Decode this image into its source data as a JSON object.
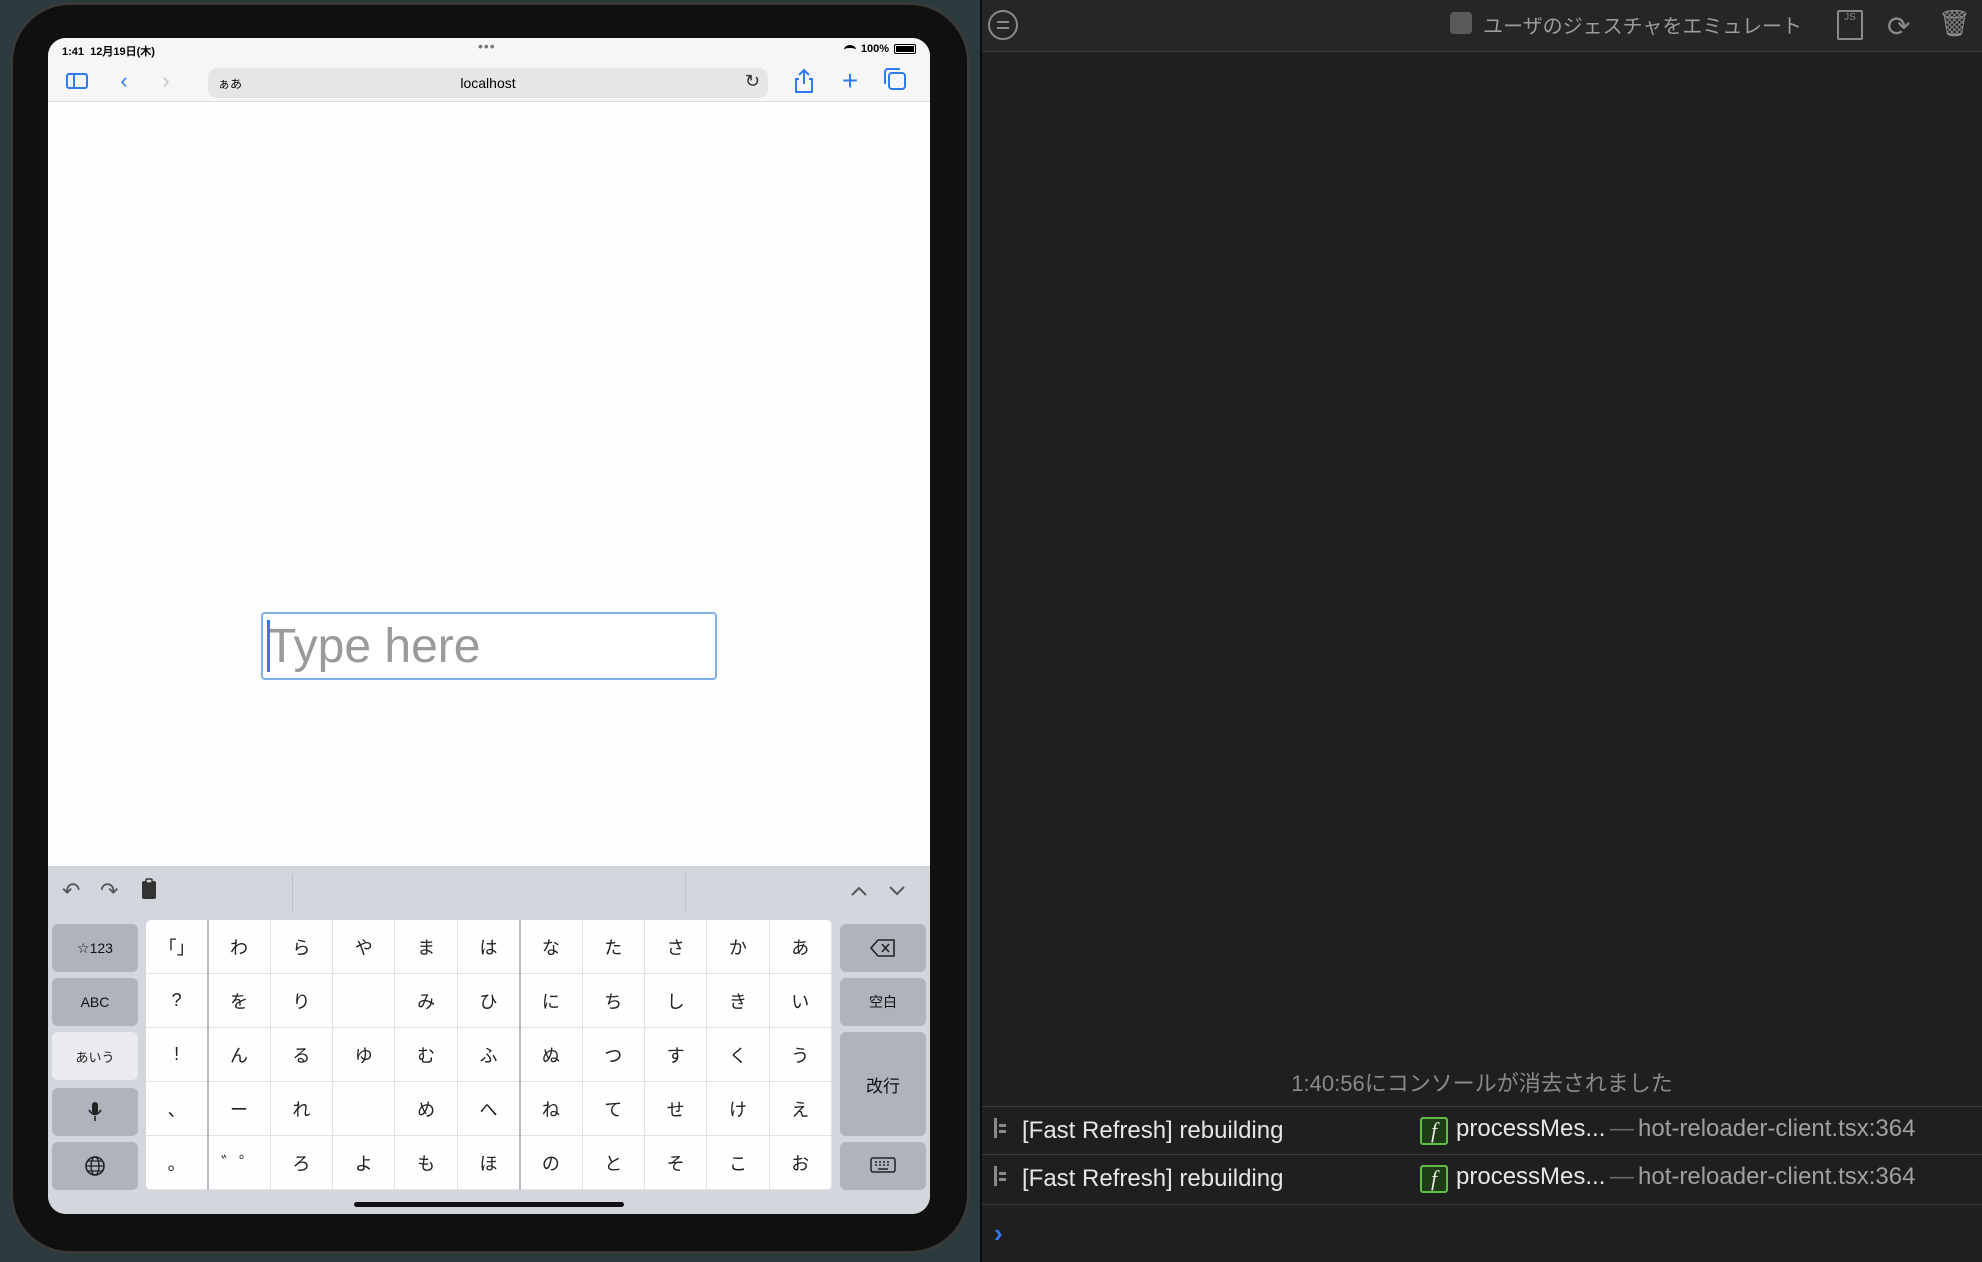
{
  "status_bar": {
    "time": "1:41",
    "date": "12月19日(木)",
    "dots": "•••",
    "battery": "100%"
  },
  "browser": {
    "text_size_label": "ぁあ",
    "url": "localhost",
    "icons": [
      "sidebar-icon",
      "back-icon",
      "forward-icon",
      "reload-icon",
      "share-icon",
      "plus-icon",
      "tabs-icon"
    ]
  },
  "page": {
    "input_placeholder": "Type here",
    "input_value": ""
  },
  "keyboard": {
    "toolbar_icons": [
      "undo-icon",
      "redo-icon",
      "paste-icon",
      "chevron-up-icon",
      "chevron-down-icon"
    ],
    "left_keys": [
      "☆123",
      "ABC",
      "あいう"
    ],
    "right_keys": {
      "space": "空白",
      "enter": "改行"
    },
    "grid": [
      [
        "「」",
        "わ",
        "ら",
        "や",
        "ま",
        "は",
        "な",
        "た",
        "さ",
        "か",
        "あ"
      ],
      [
        "?",
        "を",
        "り",
        "",
        "み",
        "ひ",
        "に",
        "ち",
        "し",
        "き",
        "い"
      ],
      [
        "!",
        "ん",
        "る",
        "ゆ",
        "む",
        "ふ",
        "ぬ",
        "つ",
        "す",
        "く",
        "う"
      ],
      [
        "、",
        "ー",
        "れ",
        "",
        "め",
        "へ",
        "ね",
        "て",
        "せ",
        "け",
        "え"
      ],
      [
        "。",
        "゛゜",
        "ろ",
        "よ",
        "も",
        "ほ",
        "の",
        "と",
        "そ",
        "こ",
        "お"
      ]
    ]
  },
  "console": {
    "emulate_label": "ユーザのジェスチャをエミュレート",
    "js_label": "JS",
    "cleared_message": "1:40:56にコンソールが消去されました",
    "messages": [
      {
        "text": "[Fast Refresh] rebuilding",
        "badge": "f",
        "function": "processMes...",
        "dash": "—",
        "source": "hot-reloader-client.tsx:364"
      },
      {
        "text": "[Fast Refresh] rebuilding",
        "badge": "f",
        "function": "processMes...",
        "dash": "—",
        "source": "hot-reloader-client.tsx:364"
      }
    ],
    "prompt": "›"
  }
}
